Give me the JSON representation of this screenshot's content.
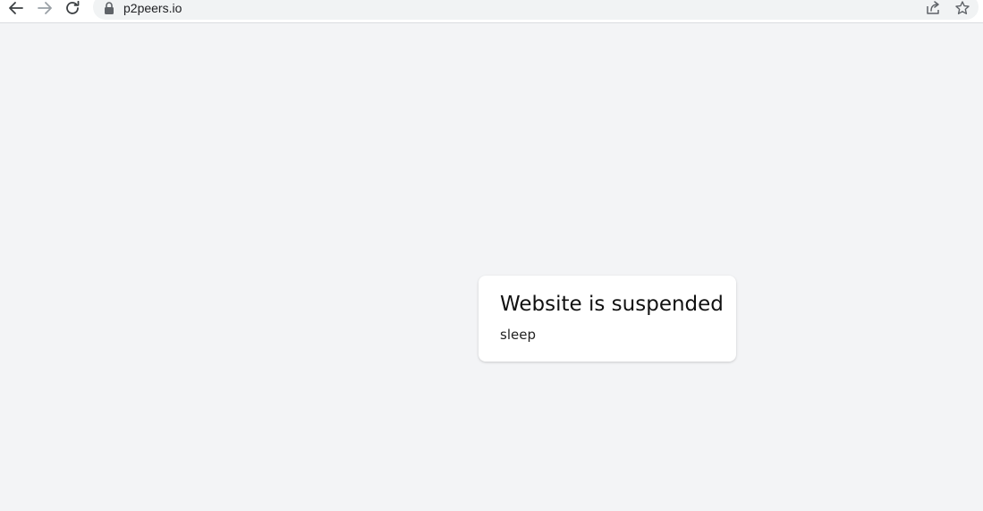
{
  "browser": {
    "url": "p2peers.io",
    "icons": {
      "back": "arrow-left-icon",
      "forward": "arrow-right-icon",
      "reload": "reload-icon",
      "lock": "lock-icon",
      "share": "share-icon",
      "bookmark": "star-icon"
    }
  },
  "main": {
    "card": {
      "title": "Website is suspended",
      "message": "sleep"
    }
  },
  "colors": {
    "page_background": "#f3f4f6",
    "card_background": "#ffffff",
    "omnibox_background": "#f1f3f4"
  }
}
